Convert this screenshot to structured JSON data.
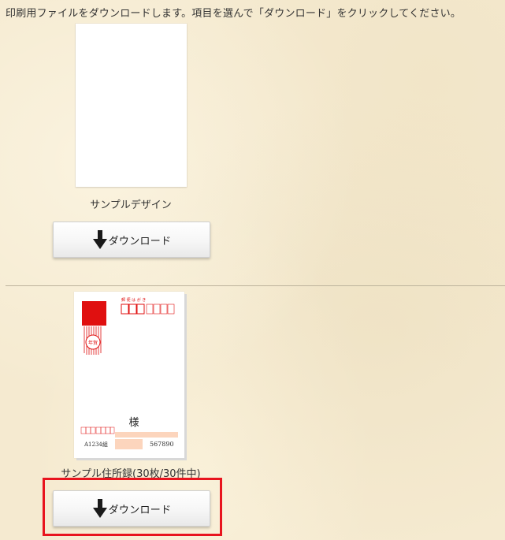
{
  "instruction": "印刷用ファイルをダウンロードします。項目を選んで「ダウンロード」をクリックしてください。",
  "items": [
    {
      "caption": "サンプルデザイン",
      "button_label": "ダウンロード",
      "button_icon": "down-arrow-icon"
    },
    {
      "caption": "サンプル住所録(30枚/30件中)",
      "button_label": "ダウンロード",
      "button_icon": "down-arrow-icon"
    }
  ],
  "postcard": {
    "header_text": "郵 便 は が き",
    "stamp_text": "年賀",
    "honorific": "様",
    "sender_code": "A1234組",
    "sender_number": "567890"
  },
  "colors": {
    "highlight": "#e8141e",
    "postcard_red": "#e01010",
    "postcard_peach": "#fcd5bd"
  }
}
